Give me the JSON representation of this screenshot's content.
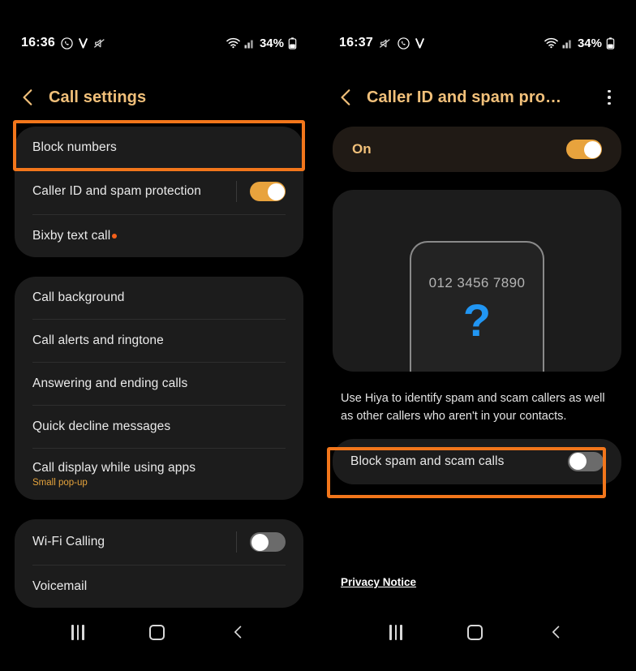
{
  "left_screen": {
    "status_bar": {
      "time": "16:36",
      "battery_percent": "34%",
      "icons": [
        "whatsapp-icon",
        "vodafone-v-icon",
        "mute-icon",
        "wifi-icon",
        "signal-icon",
        "battery-icon"
      ]
    },
    "header": {
      "title": "Call settings",
      "back_icon": "back-chevron-icon"
    },
    "groups": [
      {
        "rows": [
          {
            "label": "Block numbers",
            "type": "nav",
            "highlighted": true
          },
          {
            "label": "Caller ID and spam protection",
            "type": "toggle",
            "toggle": "on"
          },
          {
            "label": "Bixby text call",
            "type": "nav",
            "dot": true
          }
        ]
      },
      {
        "rows": [
          {
            "label": "Call background",
            "type": "nav"
          },
          {
            "label": "Call alerts and ringtone",
            "type": "nav"
          },
          {
            "label": "Answering and ending calls",
            "type": "nav"
          },
          {
            "label": "Quick decline messages",
            "type": "nav"
          },
          {
            "label": "Call display while using apps",
            "sub": "Small pop-up",
            "type": "nav"
          }
        ]
      },
      {
        "rows": [
          {
            "label": "Wi-Fi Calling",
            "type": "toggle",
            "toggle": "off"
          },
          {
            "label": "Voicemail",
            "type": "nav"
          }
        ]
      }
    ],
    "nav_bar": {
      "recent": "recent-apps-icon",
      "home": "home-icon",
      "back": "back-icon"
    }
  },
  "right_screen": {
    "status_bar": {
      "time": "16:37",
      "battery_percent": "34%",
      "icons": [
        "mute-icon",
        "whatsapp-icon",
        "vodafone-v-icon",
        "wifi-icon",
        "signal-icon",
        "battery-icon"
      ]
    },
    "header": {
      "title": "Caller ID and spam pro…",
      "back_icon": "back-chevron-icon",
      "overflow_icon": "more-options-icon"
    },
    "master_switch": {
      "label": "On",
      "toggle": "on"
    },
    "illustration": {
      "phone_number": "012 3456 7890",
      "question_mark": "?",
      "question_color": "#2196f3"
    },
    "description": "Use Hiya to identify spam and scam callers as well as other callers who aren't in your contacts.",
    "block_row": {
      "label": "Block spam and scam calls",
      "toggle": "off",
      "highlighted": true
    },
    "privacy_link": "Privacy Notice",
    "nav_bar": {
      "recent": "recent-apps-icon",
      "home": "home-icon",
      "back": "back-icon"
    }
  },
  "theme": {
    "highlight_color": "#f2761b",
    "accent_title": "#f1c07a",
    "toggle_on": "#e8a33d",
    "toggle_off": "#6b6b6b",
    "card_bg": "#1c1c1c",
    "page_bg": "#000000",
    "badge_dot": "#f4601a",
    "sub_text": "#e5a33c"
  }
}
